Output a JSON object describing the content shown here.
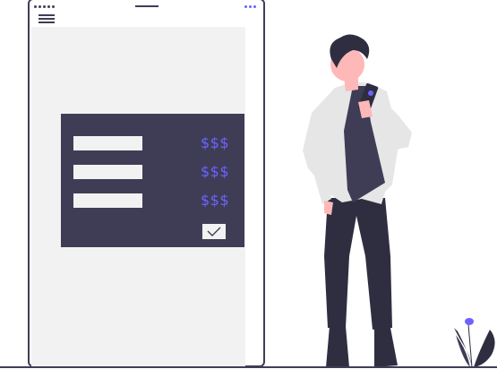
{
  "invoice": {
    "rows": [
      {
        "amount": "$$$"
      },
      {
        "amount": "$$$"
      },
      {
        "amount": "$$$"
      }
    ],
    "confirm_checked": true
  },
  "colors": {
    "primary_dark": "#3f3d56",
    "accent": "#6c63ff",
    "surface": "#f2f2f2"
  },
  "icons": {
    "menu": "hamburger-icon",
    "confirm": "checkmark-icon",
    "status": "signal-dots-icon",
    "more": "more-dots-icon"
  }
}
